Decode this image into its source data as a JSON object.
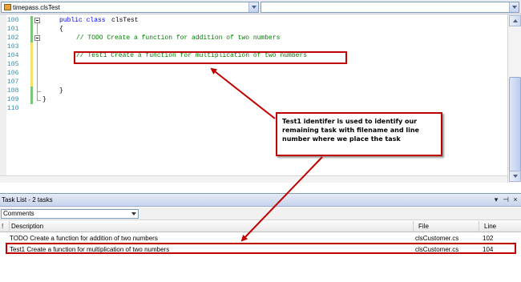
{
  "navbar": {
    "class_combo": "timepass.clsTest",
    "member_combo": ""
  },
  "editor": {
    "lines": [
      {
        "num": "100",
        "kw": "public class ",
        "text": "clsTest",
        "comment": ""
      },
      {
        "num": "101",
        "kw": "",
        "text": "{",
        "comment": ""
      },
      {
        "num": "102",
        "kw": "",
        "text": "",
        "comment": "// TODO Create a function for addition of two numbers"
      },
      {
        "num": "103",
        "kw": "",
        "text": "",
        "comment": ""
      },
      {
        "num": "104",
        "kw": "",
        "text": "",
        "comment": "// Test1 Create a function for multiplication of two numbers"
      },
      {
        "num": "105",
        "kw": "",
        "text": "",
        "comment": ""
      },
      {
        "num": "106",
        "kw": "",
        "text": "",
        "comment": ""
      },
      {
        "num": "107",
        "kw": "",
        "text": "",
        "comment": ""
      },
      {
        "num": "108",
        "kw": "",
        "text": "}",
        "comment": ""
      },
      {
        "num": "109",
        "kw": "",
        "text": "}",
        "comment": ""
      },
      {
        "num": "110",
        "kw": "",
        "text": "",
        "comment": ""
      }
    ]
  },
  "callout": {
    "text": "Test1 identifer is used to identify our remaining task with filename and line number where we place the task"
  },
  "task_list": {
    "title": "Task List - 2 tasks",
    "controls": {
      "dropdown": "▾",
      "pin": "⊣",
      "close": "×"
    },
    "filter": "Comments",
    "columns": {
      "priority": "!",
      "description": "Description",
      "file": "File",
      "line": "Line"
    },
    "rows": [
      {
        "description": "TODO Create a function for addition of two numbers",
        "file": "clsCustomer.cs",
        "line": "102"
      },
      {
        "description": "Test1 Create a function for multiplication of two numbers",
        "file": "clsCustomer.cs",
        "line": "104"
      }
    ]
  },
  "colors": {
    "keyword": "#0000ff",
    "comment": "#008000",
    "line_number": "#2b91af",
    "annotation": "#c00000"
  }
}
